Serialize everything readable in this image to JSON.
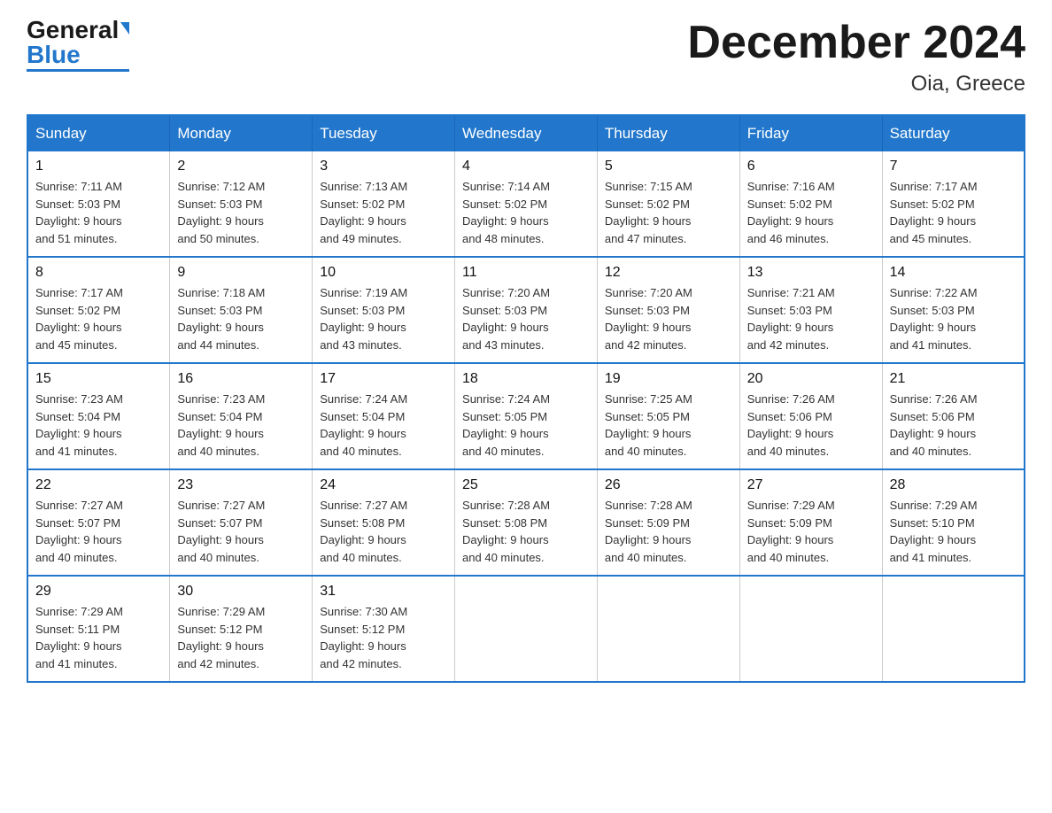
{
  "header": {
    "logo_general": "General",
    "logo_blue": "Blue",
    "month_title": "December 2024",
    "location": "Oia, Greece"
  },
  "weekdays": [
    "Sunday",
    "Monday",
    "Tuesday",
    "Wednesday",
    "Thursday",
    "Friday",
    "Saturday"
  ],
  "weeks": [
    [
      {
        "day": "1",
        "sunrise": "7:11 AM",
        "sunset": "5:03 PM",
        "daylight": "9 hours and 51 minutes."
      },
      {
        "day": "2",
        "sunrise": "7:12 AM",
        "sunset": "5:03 PM",
        "daylight": "9 hours and 50 minutes."
      },
      {
        "day": "3",
        "sunrise": "7:13 AM",
        "sunset": "5:02 PM",
        "daylight": "9 hours and 49 minutes."
      },
      {
        "day": "4",
        "sunrise": "7:14 AM",
        "sunset": "5:02 PM",
        "daylight": "9 hours and 48 minutes."
      },
      {
        "day": "5",
        "sunrise": "7:15 AM",
        "sunset": "5:02 PM",
        "daylight": "9 hours and 47 minutes."
      },
      {
        "day": "6",
        "sunrise": "7:16 AM",
        "sunset": "5:02 PM",
        "daylight": "9 hours and 46 minutes."
      },
      {
        "day": "7",
        "sunrise": "7:17 AM",
        "sunset": "5:02 PM",
        "daylight": "9 hours and 45 minutes."
      }
    ],
    [
      {
        "day": "8",
        "sunrise": "7:17 AM",
        "sunset": "5:02 PM",
        "daylight": "9 hours and 45 minutes."
      },
      {
        "day": "9",
        "sunrise": "7:18 AM",
        "sunset": "5:03 PM",
        "daylight": "9 hours and 44 minutes."
      },
      {
        "day": "10",
        "sunrise": "7:19 AM",
        "sunset": "5:03 PM",
        "daylight": "9 hours and 43 minutes."
      },
      {
        "day": "11",
        "sunrise": "7:20 AM",
        "sunset": "5:03 PM",
        "daylight": "9 hours and 43 minutes."
      },
      {
        "day": "12",
        "sunrise": "7:20 AM",
        "sunset": "5:03 PM",
        "daylight": "9 hours and 42 minutes."
      },
      {
        "day": "13",
        "sunrise": "7:21 AM",
        "sunset": "5:03 PM",
        "daylight": "9 hours and 42 minutes."
      },
      {
        "day": "14",
        "sunrise": "7:22 AM",
        "sunset": "5:03 PM",
        "daylight": "9 hours and 41 minutes."
      }
    ],
    [
      {
        "day": "15",
        "sunrise": "7:23 AM",
        "sunset": "5:04 PM",
        "daylight": "9 hours and 41 minutes."
      },
      {
        "day": "16",
        "sunrise": "7:23 AM",
        "sunset": "5:04 PM",
        "daylight": "9 hours and 40 minutes."
      },
      {
        "day": "17",
        "sunrise": "7:24 AM",
        "sunset": "5:04 PM",
        "daylight": "9 hours and 40 minutes."
      },
      {
        "day": "18",
        "sunrise": "7:24 AM",
        "sunset": "5:05 PM",
        "daylight": "9 hours and 40 minutes."
      },
      {
        "day": "19",
        "sunrise": "7:25 AM",
        "sunset": "5:05 PM",
        "daylight": "9 hours and 40 minutes."
      },
      {
        "day": "20",
        "sunrise": "7:26 AM",
        "sunset": "5:06 PM",
        "daylight": "9 hours and 40 minutes."
      },
      {
        "day": "21",
        "sunrise": "7:26 AM",
        "sunset": "5:06 PM",
        "daylight": "9 hours and 40 minutes."
      }
    ],
    [
      {
        "day": "22",
        "sunrise": "7:27 AM",
        "sunset": "5:07 PM",
        "daylight": "9 hours and 40 minutes."
      },
      {
        "day": "23",
        "sunrise": "7:27 AM",
        "sunset": "5:07 PM",
        "daylight": "9 hours and 40 minutes."
      },
      {
        "day": "24",
        "sunrise": "7:27 AM",
        "sunset": "5:08 PM",
        "daylight": "9 hours and 40 minutes."
      },
      {
        "day": "25",
        "sunrise": "7:28 AM",
        "sunset": "5:08 PM",
        "daylight": "9 hours and 40 minutes."
      },
      {
        "day": "26",
        "sunrise": "7:28 AM",
        "sunset": "5:09 PM",
        "daylight": "9 hours and 40 minutes."
      },
      {
        "day": "27",
        "sunrise": "7:29 AM",
        "sunset": "5:09 PM",
        "daylight": "9 hours and 40 minutes."
      },
      {
        "day": "28",
        "sunrise": "7:29 AM",
        "sunset": "5:10 PM",
        "daylight": "9 hours and 41 minutes."
      }
    ],
    [
      {
        "day": "29",
        "sunrise": "7:29 AM",
        "sunset": "5:11 PM",
        "daylight": "9 hours and 41 minutes."
      },
      {
        "day": "30",
        "sunrise": "7:29 AM",
        "sunset": "5:12 PM",
        "daylight": "9 hours and 42 minutes."
      },
      {
        "day": "31",
        "sunrise": "7:30 AM",
        "sunset": "5:12 PM",
        "daylight": "9 hours and 42 minutes."
      },
      null,
      null,
      null,
      null
    ]
  ],
  "labels": {
    "sunrise": "Sunrise:",
    "sunset": "Sunset:",
    "daylight": "Daylight:"
  }
}
